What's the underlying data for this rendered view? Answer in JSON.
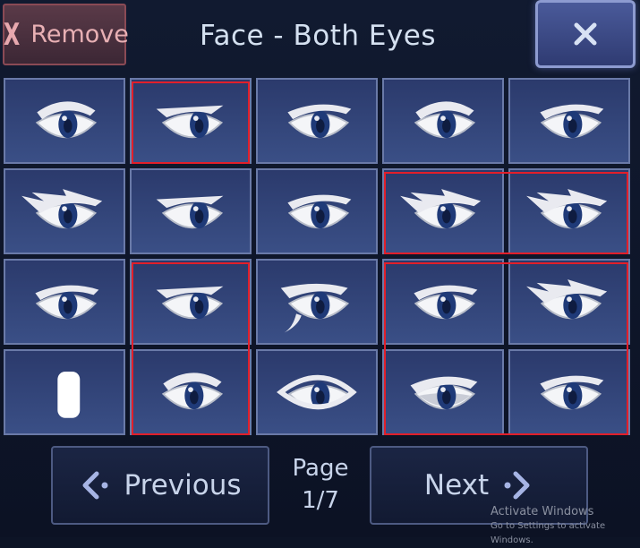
{
  "header": {
    "remove_icon": "x-glyph",
    "remove_label": "Remove",
    "title": "Face - Both Eyes",
    "close_icon": "close-icon"
  },
  "grid": {
    "rows": 4,
    "cols": 5,
    "items": [
      {
        "style": "round",
        "selected": false
      },
      {
        "style": "sharp",
        "selected": true
      },
      {
        "style": "narrow",
        "selected": false
      },
      {
        "style": "round",
        "selected": false
      },
      {
        "style": "narrow",
        "selected": false
      },
      {
        "style": "spiky",
        "selected": false
      },
      {
        "style": "sharp",
        "selected": false
      },
      {
        "style": "narrow",
        "selected": false
      },
      {
        "style": "spiky",
        "selected": true
      },
      {
        "style": "spiky",
        "selected": true
      },
      {
        "style": "narrow",
        "selected": false
      },
      {
        "style": "sharp",
        "selected": true
      },
      {
        "style": "tail",
        "selected": false
      },
      {
        "style": "narrow",
        "selected": true
      },
      {
        "style": "spiky",
        "selected": true
      },
      {
        "style": "white-shape",
        "selected": false
      },
      {
        "style": "round",
        "selected": true
      },
      {
        "style": "almond",
        "selected": false
      },
      {
        "style": "shaded",
        "selected": true
      },
      {
        "style": "narrow",
        "selected": true
      }
    ],
    "highlight_color": "#e21f2a",
    "tile_color": "#3a4f86"
  },
  "footer": {
    "previous_label": "Previous",
    "next_label": "Next",
    "page_label": "Page",
    "page_value": "1/7",
    "prev_icon": "chevron-left-icon",
    "next_icon": "chevron-right-icon"
  },
  "watermark": {
    "line1": "Activate Windows",
    "line2": "Go to Settings to activate Windows."
  }
}
